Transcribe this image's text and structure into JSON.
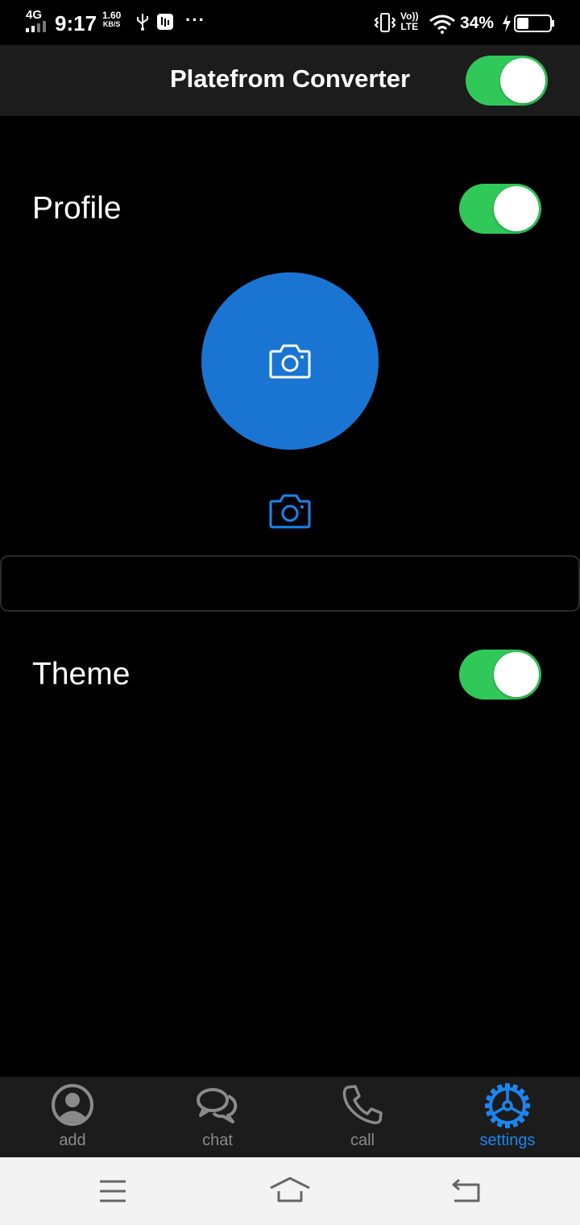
{
  "status_bar": {
    "network": "4G",
    "time": "9:17",
    "speed_value": "1.60",
    "speed_unit": "KB/S",
    "volte_top": "Vo))",
    "volte_bottom": "LTE",
    "battery_percent": "34%",
    "overflow": "···"
  },
  "header": {
    "title": "Platefrom Converter",
    "toggle_on": true
  },
  "profile": {
    "label": "Profile",
    "toggle_on": true
  },
  "name_input": {
    "value": "",
    "placeholder": ""
  },
  "theme": {
    "label": "Theme",
    "toggle_on": true
  },
  "bottom_nav": {
    "items": [
      {
        "label": "add",
        "icon": "account-circle-icon",
        "active": false
      },
      {
        "label": "chat",
        "icon": "chat-bubbles-icon",
        "active": false
      },
      {
        "label": "call",
        "icon": "phone-icon",
        "active": false
      },
      {
        "label": "settings",
        "icon": "gear-icon",
        "active": true
      }
    ]
  },
  "colors": {
    "toggle_on": "#31c85a",
    "accent": "#1a86f0",
    "avatar": "#1a75d2",
    "header_bg": "#1c1c1c",
    "inactive": "#8a8a8a"
  }
}
